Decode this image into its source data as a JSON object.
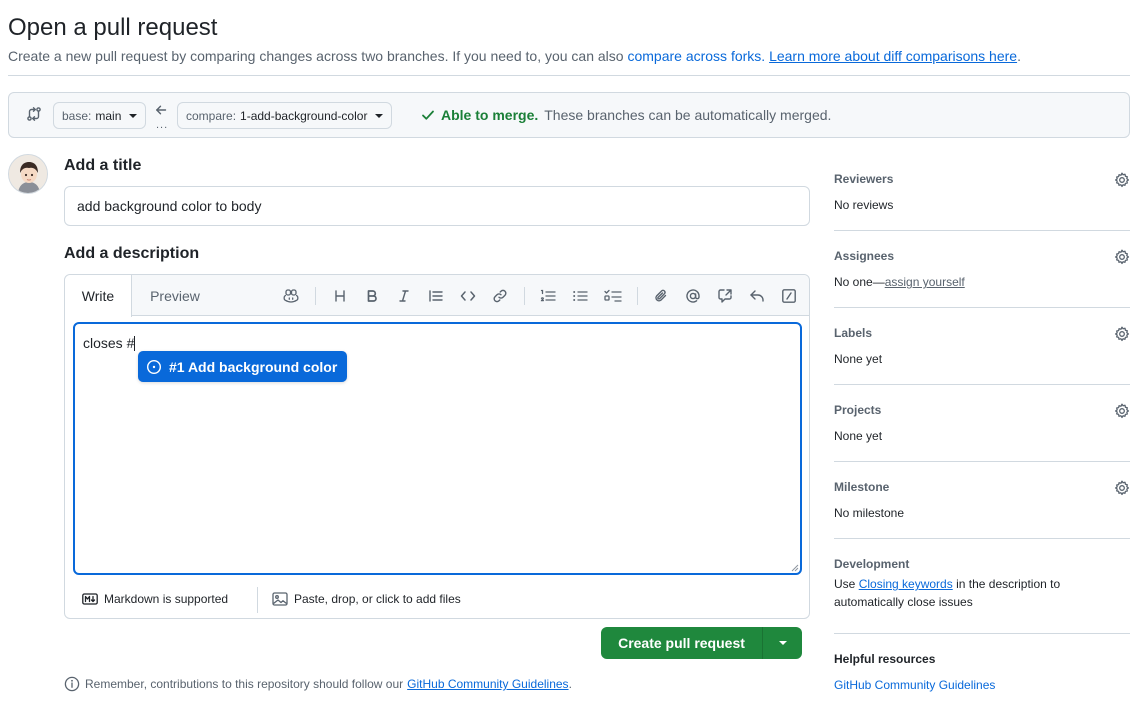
{
  "header": {
    "title": "Open a pull request",
    "subtitle_prefix": "Create a new pull request by comparing changes across two branches. If you need to, you can also",
    "compare_forks_link": "compare across forks.",
    "learn_more_link": "Learn more about diff comparisons here",
    "subtitle_suffix": "."
  },
  "compare": {
    "base_prefix": "base:",
    "base_branch": "main",
    "compare_prefix": "compare:",
    "compare_branch": "1-add-background-color",
    "dots": "...",
    "merge_status": "Able to merge.",
    "merge_detail": "These branches can be automatically merged."
  },
  "form": {
    "title_label": "Add a title",
    "title_value": "add background color to body",
    "description_label": "Add a description",
    "tabs": [
      "Write",
      "Preview"
    ],
    "body_text": "closes #",
    "suggestion": "#1 Add background color",
    "markdown_hint": "Markdown is supported",
    "attach_hint": "Paste, drop, or click to add files",
    "submit_label": "Create pull request"
  },
  "footer": {
    "remember_prefix": "Remember, contributions to this repository should follow our",
    "guidelines_link": "GitHub Community Guidelines",
    "remember_suffix": "."
  },
  "sidebar": {
    "reviewers": {
      "title": "Reviewers",
      "value": "No reviews"
    },
    "assignees": {
      "title": "Assignees",
      "value_prefix": "No one—",
      "value_link": "assign yourself"
    },
    "labels": {
      "title": "Labels",
      "value": "None yet"
    },
    "projects": {
      "title": "Projects",
      "value": "None yet"
    },
    "milestone": {
      "title": "Milestone",
      "value": "No milestone"
    },
    "development": {
      "title": "Development",
      "prefix": "Use",
      "link": "Closing keywords",
      "suffix": "in the description to automatically close issues"
    },
    "helpful": {
      "title": "Helpful resources",
      "link": "GitHub Community Guidelines"
    }
  },
  "colors": {
    "accent": "#0969da",
    "success": "#1a7f37",
    "button_green": "#1f883d",
    "muted": "#59636e",
    "border": "#d1d9e0"
  },
  "icons": [
    "git-compare-icon",
    "arrow-left-icon",
    "check-icon",
    "copilot-icon",
    "heading-icon",
    "bold-icon",
    "italic-icon",
    "quote-icon",
    "code-icon",
    "link-icon",
    "ordered-list-icon",
    "unordered-list-icon",
    "task-list-icon",
    "paperclip-icon",
    "mention-icon",
    "cross-reference-icon",
    "reply-icon",
    "slash-commands-icon",
    "issue-opened-icon",
    "markdown-icon",
    "image-icon",
    "info-icon",
    "gear-icon"
  ]
}
